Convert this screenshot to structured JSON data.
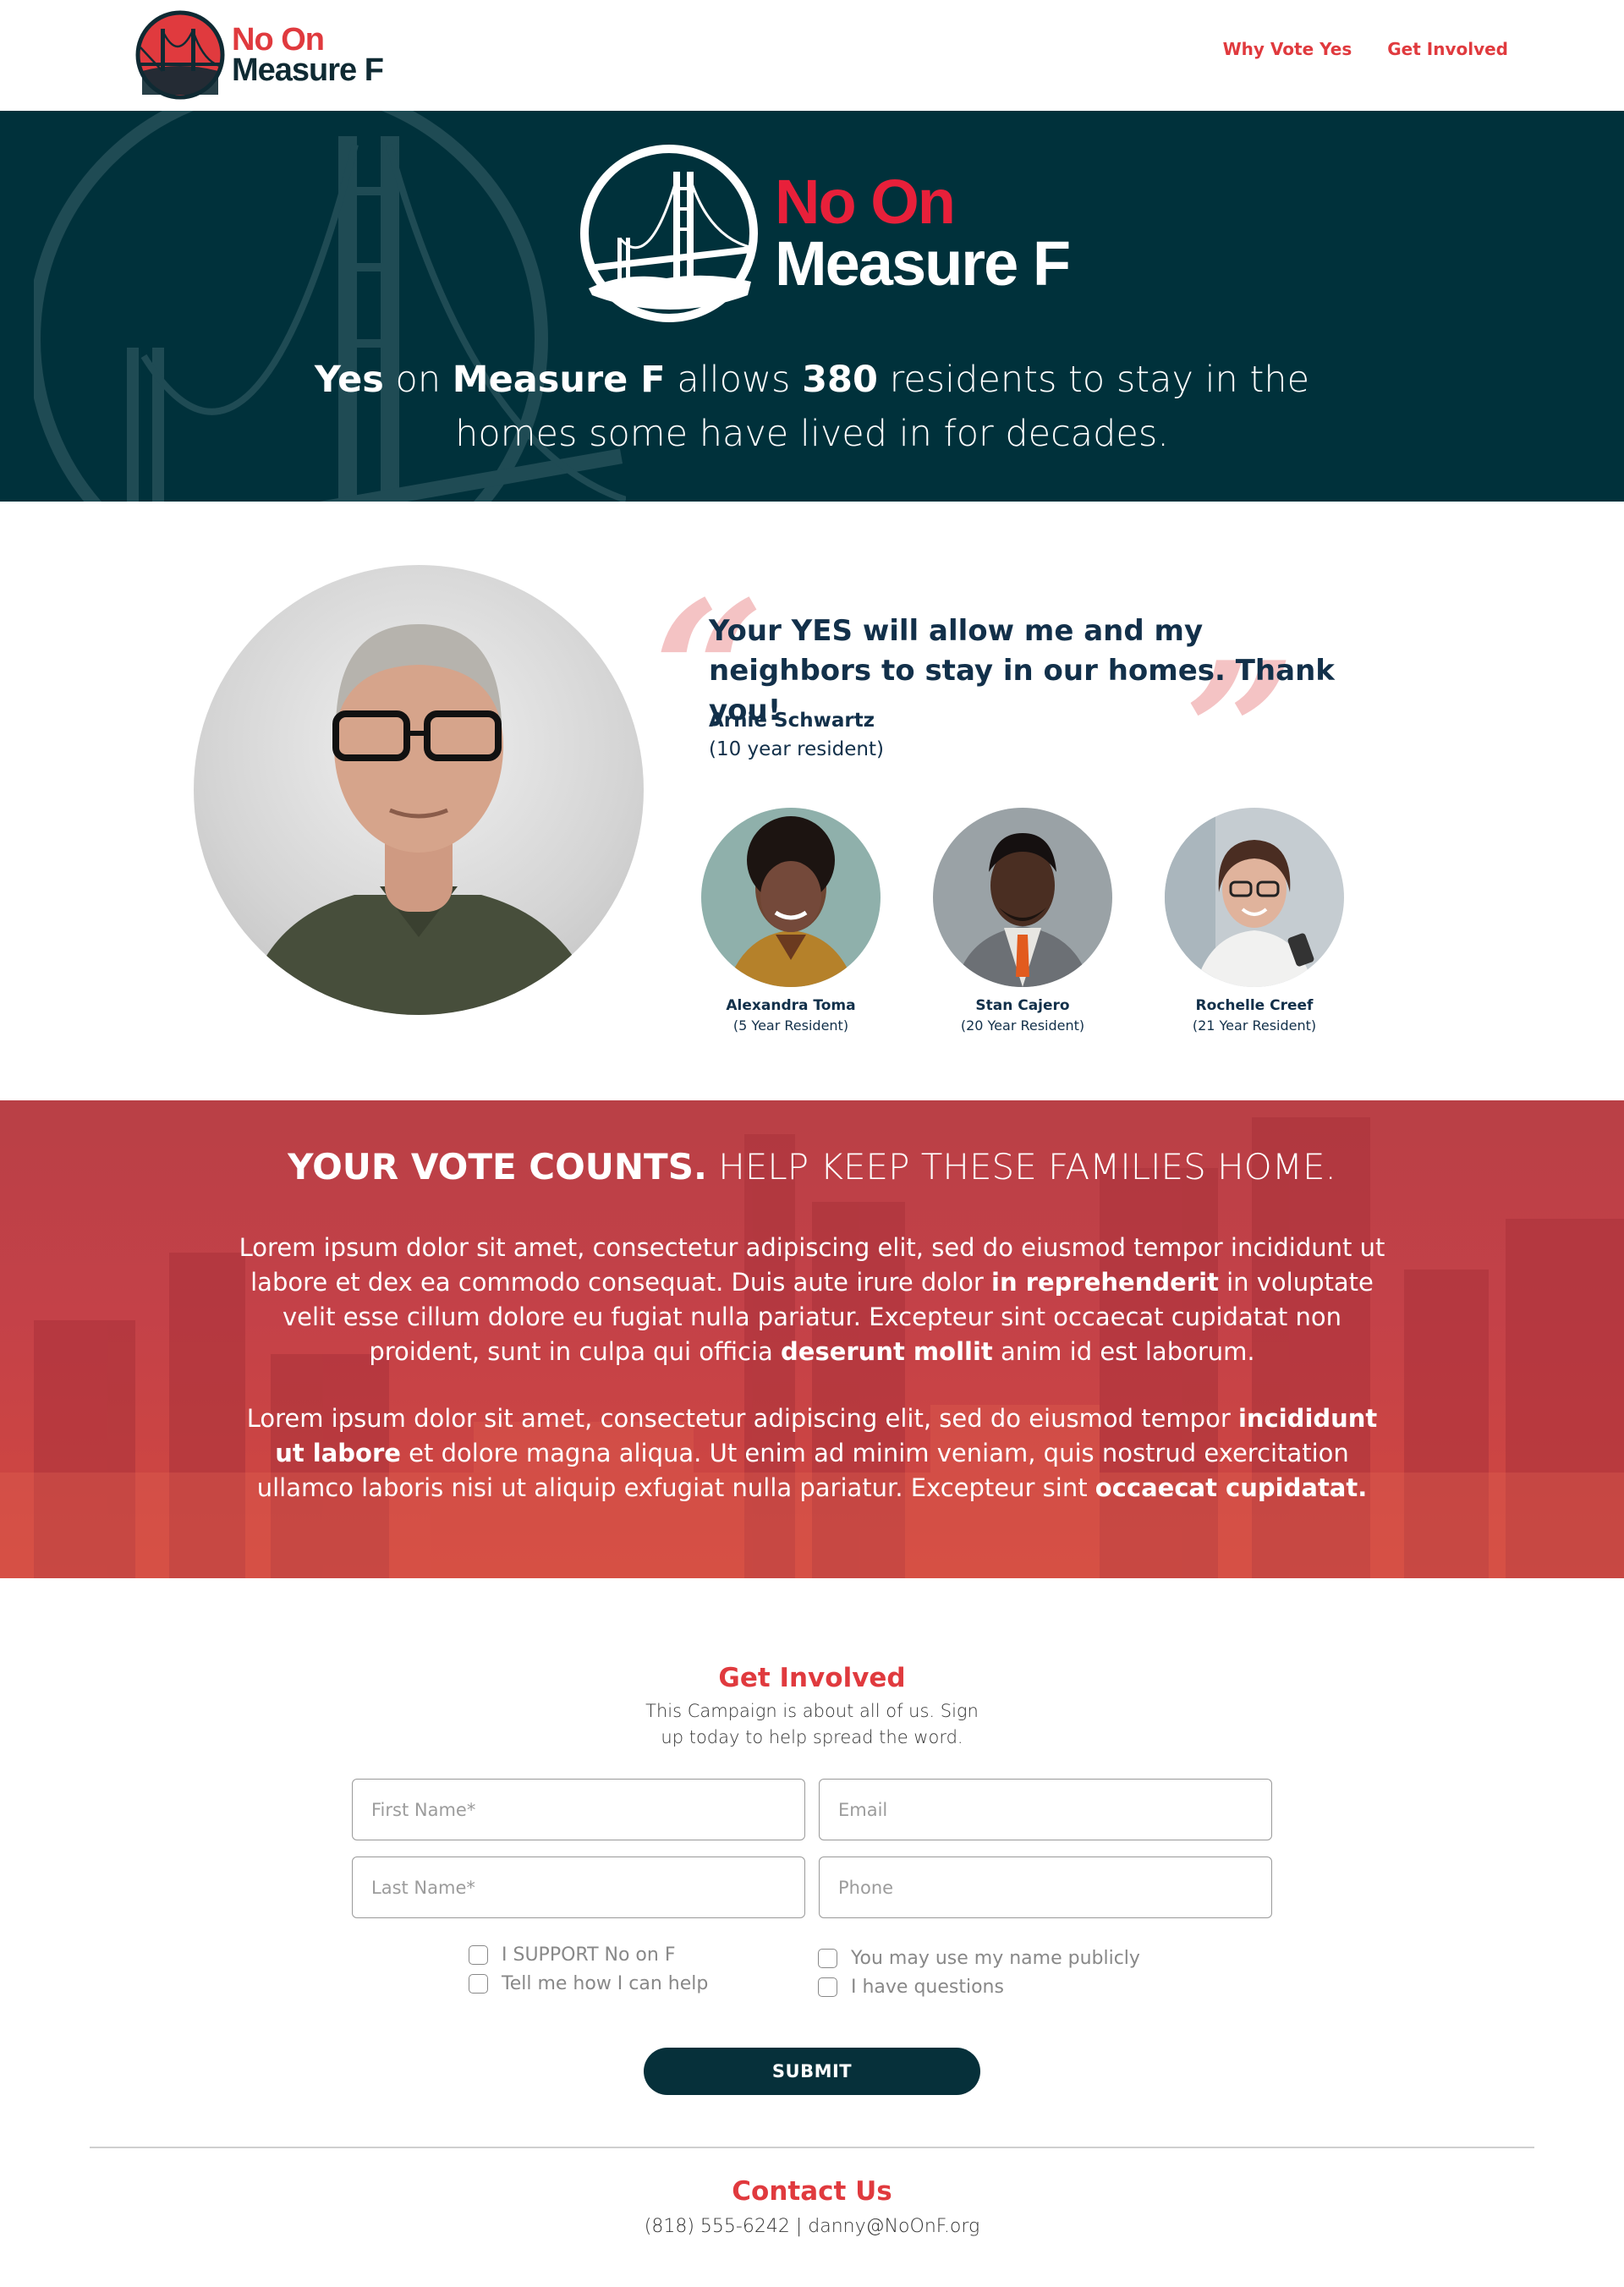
{
  "header": {
    "logo_line1": "No On",
    "logo_line2": "Measure F",
    "nav": [
      "Why Vote Yes",
      "Get Involved"
    ]
  },
  "hero": {
    "logo_line1": "No On",
    "logo_line2": "Measure F",
    "tagline_parts": [
      "Yes",
      " on ",
      "Measure F",
      " allows ",
      "380",
      " residents to stay in the homes some have lived in for decades."
    ]
  },
  "testimonial": {
    "quote": "Your YES will allow me and my neighbors to stay in our homes. Thank you!",
    "name": "Arnie Schwartz",
    "years": "(10 year resident)",
    "residents": [
      {
        "name": "Alexandra Toma",
        "years": "(5 Year Resident)"
      },
      {
        "name": "Stan Cajero",
        "years": "(20 Year Resident)"
      },
      {
        "name": "Rochelle Creef",
        "years": "(21 Year Resident)"
      }
    ]
  },
  "vote": {
    "heading_bold": "YOUR VOTE COUNTS.",
    "heading_light": " HELP KEEP THESE FAMILIES HOME.",
    "p1": [
      "Lorem ipsum dolor sit amet, consectetur adipiscing elit, sed do eiusmod tempor incididunt ut labore et dex ea commodo consequat. Duis aute irure dolor ",
      "in reprehenderit",
      " in voluptate velit esse cillum dolore eu fugiat nulla pariatur. Excepteur sint occaecat cupidatat non proident, sunt in culpa qui officia ",
      "deserunt mollit",
      " anim id est laborum."
    ],
    "p2": [
      "Lorem ipsum dolor sit amet, consectetur adipiscing elit, sed do eiusmod tempor ",
      "incididunt ut labore",
      " et dolore magna aliqua. Ut enim ad minim veniam, quis nostrud exercitation ullamco laboris nisi ut aliquip exfugiat nulla pariatur. Excepteur sint ",
      "occaecat cupidatat."
    ]
  },
  "form": {
    "title": "Get Involved",
    "subtitle": "This Campaign is about all of us. Sign up today to help spread the word.",
    "fields": {
      "first_name": "First Name*",
      "email": "Email",
      "last_name": "Last Name*",
      "phone": "Phone"
    },
    "checkboxes": [
      "I SUPPORT No on F",
      "Tell me how I can help",
      "You may use my name publicly",
      "I have questions"
    ],
    "submit": "SUBMIT"
  },
  "contact": {
    "title": "Contact Us",
    "info": "(818) 555-6242 | danny@NoOnF.org"
  },
  "colors": {
    "brand_red": "#e03a3e",
    "navy": "#00313b",
    "quote_navy": "#12304a"
  }
}
